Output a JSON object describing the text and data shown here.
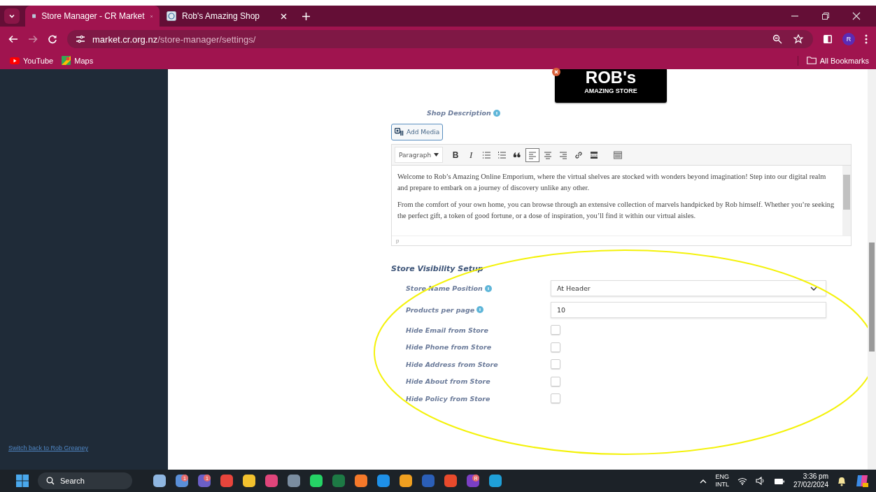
{
  "browser": {
    "tabs": [
      {
        "title": "Store Manager - CR Market",
        "selected": true
      },
      {
        "title": "Rob's Amazing Shop",
        "selected": false
      }
    ],
    "url": {
      "host": "market.cr.org.nz",
      "path": "/store-manager/settings/"
    },
    "profile_initial": "R",
    "bookmarks": [
      {
        "label": "YouTube",
        "kind": "youtube"
      },
      {
        "label": "Maps",
        "kind": "maps"
      }
    ],
    "all_bookmarks": "All Bookmarks"
  },
  "sidebar": {
    "switch_link": "Switch back to Rob Greaney"
  },
  "logo": {
    "title": "ROB's",
    "subtitle": "AMAZING STORE"
  },
  "shop_description": {
    "label": "Shop Description",
    "add_media": "Add Media",
    "format": "Paragraph",
    "toolbar": [
      {
        "kind": "bold",
        "label": "B",
        "selected": false
      },
      {
        "kind": "italic",
        "label": "I",
        "selected": false
      },
      {
        "kind": "bullets",
        "selected": false
      },
      {
        "kind": "numbers",
        "selected": false
      },
      {
        "kind": "quote",
        "selected": false
      },
      {
        "kind": "align-left",
        "selected": true
      },
      {
        "kind": "align-center",
        "selected": false
      },
      {
        "kind": "align-right",
        "selected": false
      },
      {
        "kind": "link",
        "selected": false
      },
      {
        "kind": "more",
        "selected": false
      },
      {
        "kind": "toggle",
        "selected": false
      }
    ],
    "paragraphs": [
      "Welcome to Rob’s Amazing Online Emporium, where the virtual shelves are stocked with wonders beyond imagination! Step into our digital realm and prepare to embark on a journey of discovery unlike any other.",
      "From the comfort of your own home, you can browse through an extensive collection of marvels handpicked by Rob himself. Whether you’re seeking the perfect gift, a token of good fortune, or a dose of inspiration, you’ll find it within our virtual aisles."
    ],
    "path": "p"
  },
  "visibility": {
    "title": "Store Visibility Setup",
    "fields": [
      {
        "label": "Store Name Position",
        "kind": "select",
        "value": "At Header",
        "help": true
      },
      {
        "label": "Products per page",
        "kind": "text",
        "value": "10",
        "help": true
      },
      {
        "label": "Hide Email from Store",
        "kind": "checkbox",
        "checked": false,
        "help": false
      },
      {
        "label": "Hide Phone from Store",
        "kind": "checkbox",
        "checked": false,
        "help": false
      },
      {
        "label": "Hide Address from Store",
        "kind": "checkbox",
        "checked": false,
        "help": false
      },
      {
        "label": "Hide About from Store",
        "kind": "checkbox",
        "checked": false,
        "help": false
      },
      {
        "label": "Hide Policy from Store",
        "kind": "checkbox",
        "checked": false,
        "help": false
      }
    ]
  },
  "taskbar": {
    "search": "Search",
    "apps": [
      {
        "color": "#8fb6e0"
      },
      {
        "color": "#5a8fd8",
        "badge": "1"
      },
      {
        "color": "#6b5fc7",
        "badge": "1"
      },
      {
        "color": "#e8453c"
      },
      {
        "color": "#f2c12e"
      },
      {
        "color": "#e0457b"
      },
      {
        "color": "#7a8da0"
      },
      {
        "color": "#25d366"
      },
      {
        "color": "#1d7a45"
      },
      {
        "color": "#f5792a"
      },
      {
        "color": "#1e90e8"
      },
      {
        "color": "#f0a020"
      },
      {
        "color": "#2b5fb8"
      },
      {
        "color": "#e84a2c"
      },
      {
        "color": "#7b3fc4",
        "badge": "R"
      },
      {
        "color": "#1fa0d8"
      }
    ],
    "lang": "ENG",
    "layout": "INTL",
    "time": "3:36 pm",
    "date": "27/02/2024"
  }
}
